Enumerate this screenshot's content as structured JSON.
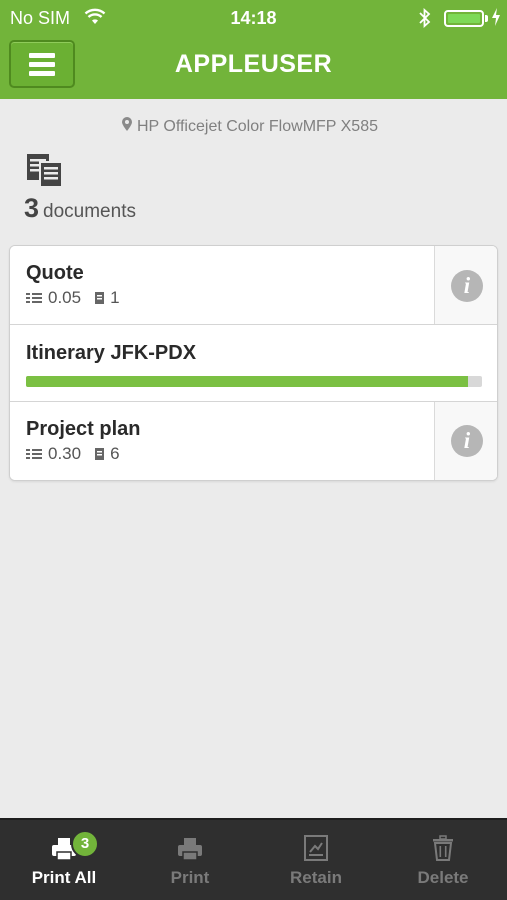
{
  "status_bar": {
    "carrier": "No SIM",
    "time": "14:18"
  },
  "header": {
    "title": "APPLEUSER",
    "menu_icon": "hamburger-menu-icon",
    "background_color": "#72b43a"
  },
  "printer": {
    "name": "HP Officejet Color FlowMFP X585",
    "icon": "location-pin-icon"
  },
  "summary": {
    "count": "3",
    "label": "documents",
    "icon": "documents-icon"
  },
  "documents": [
    {
      "name": "Quote",
      "cost": "0.05",
      "pages": "1",
      "info_icon": "info-icon"
    },
    {
      "name": "Itinerary JFK-PDX",
      "progress_fraction": 0.97
    },
    {
      "name": "Project plan",
      "cost": "0.30",
      "pages": "6",
      "info_icon": "info-icon"
    }
  ],
  "toolbar": {
    "print_all": {
      "label": "Print All",
      "badge": "3",
      "icon": "printer-icon"
    },
    "print": {
      "label": "Print",
      "icon": "printer-icon"
    },
    "retain": {
      "label": "Retain",
      "icon": "retain-document-icon"
    },
    "delete": {
      "label": "Delete",
      "icon": "trash-icon"
    }
  },
  "colors": {
    "accent": "#72b43a",
    "progress": "#7bc043",
    "toolbar_bg": "#2f2f2f"
  }
}
